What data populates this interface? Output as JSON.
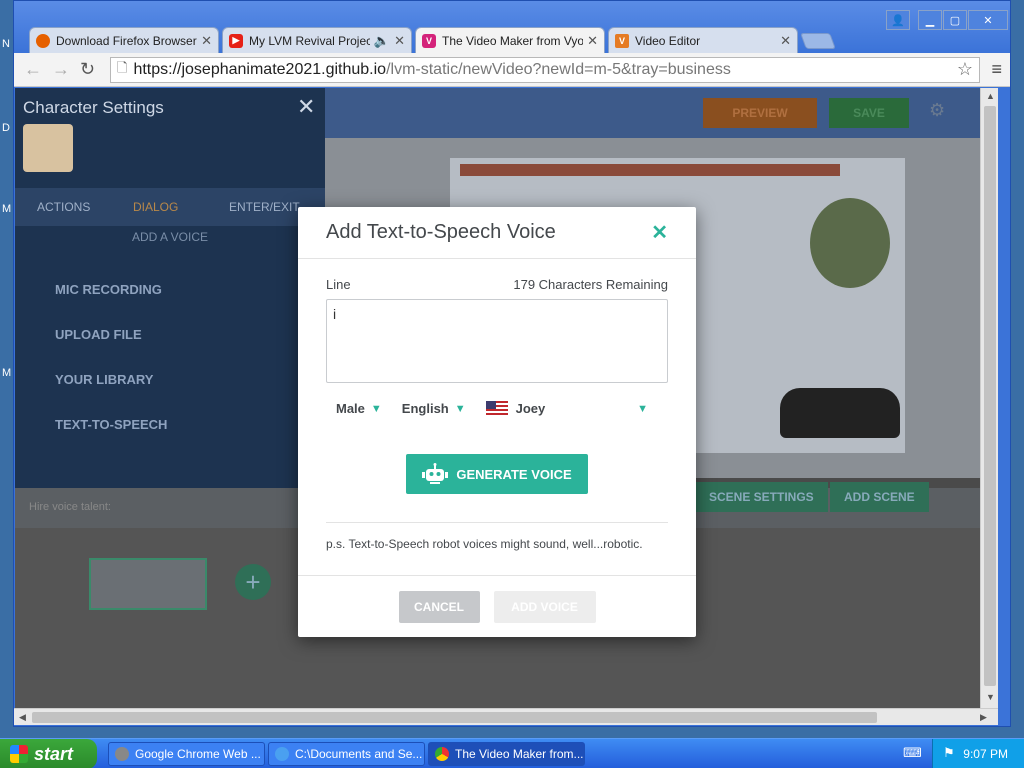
{
  "desktop": {
    "letters": [
      "N",
      "D",
      "M",
      "M"
    ]
  },
  "browser": {
    "tabs": [
      {
        "label": "Download Firefox Browser —",
        "icon": "firefox-icon",
        "color": "#e66000"
      },
      {
        "label": "My LVM Revival Project F",
        "icon": "youtube-icon",
        "color": "#e62117"
      },
      {
        "label": "The Video Maker from Vyond",
        "icon": "vyond-icon",
        "color": "#d4237a"
      },
      {
        "label": "Video Editor",
        "icon": "video-editor-icon",
        "color": "#e57b24"
      }
    ],
    "url_host": "https://josephanimate2021.github.io",
    "url_path": "/lvm-static/newVideo?newId=m-5&tray=business"
  },
  "studio": {
    "panel_title": "Character Settings",
    "tabs": [
      "ACTIONS",
      "DIALOG",
      "ENTER/EXIT"
    ],
    "add_voice": "ADD A VOICE",
    "items": [
      "MIC RECORDING",
      "UPLOAD FILE",
      "YOUR LIBRARY",
      "TEXT-TO-SPEECH"
    ],
    "preview": "PREVIEW",
    "save": "SAVE",
    "hire": "Hire voice talent:",
    "scene_settings": "SCENE SETTINGS",
    "add_scene": "ADD SCENE"
  },
  "modal": {
    "title": "Add Text-to-Speech Voice",
    "line_label": "Line",
    "chars_remaining": "179 Characters Remaining",
    "line_value": "i",
    "gender": "Male",
    "language": "English",
    "voice": "Joey",
    "generate": "GENERATE VOICE",
    "ps": "p.s. Text-to-Speech robot voices might sound, well...robotic.",
    "cancel": "CANCEL",
    "add_voice": "ADD VOICE",
    "accent_color": "#2bb39a"
  },
  "taskbar": {
    "start": "start",
    "tasks": [
      "Google Chrome Web ...",
      "C:\\Documents and Se...",
      "The Video Maker from..."
    ],
    "time": "9:07 PM"
  }
}
